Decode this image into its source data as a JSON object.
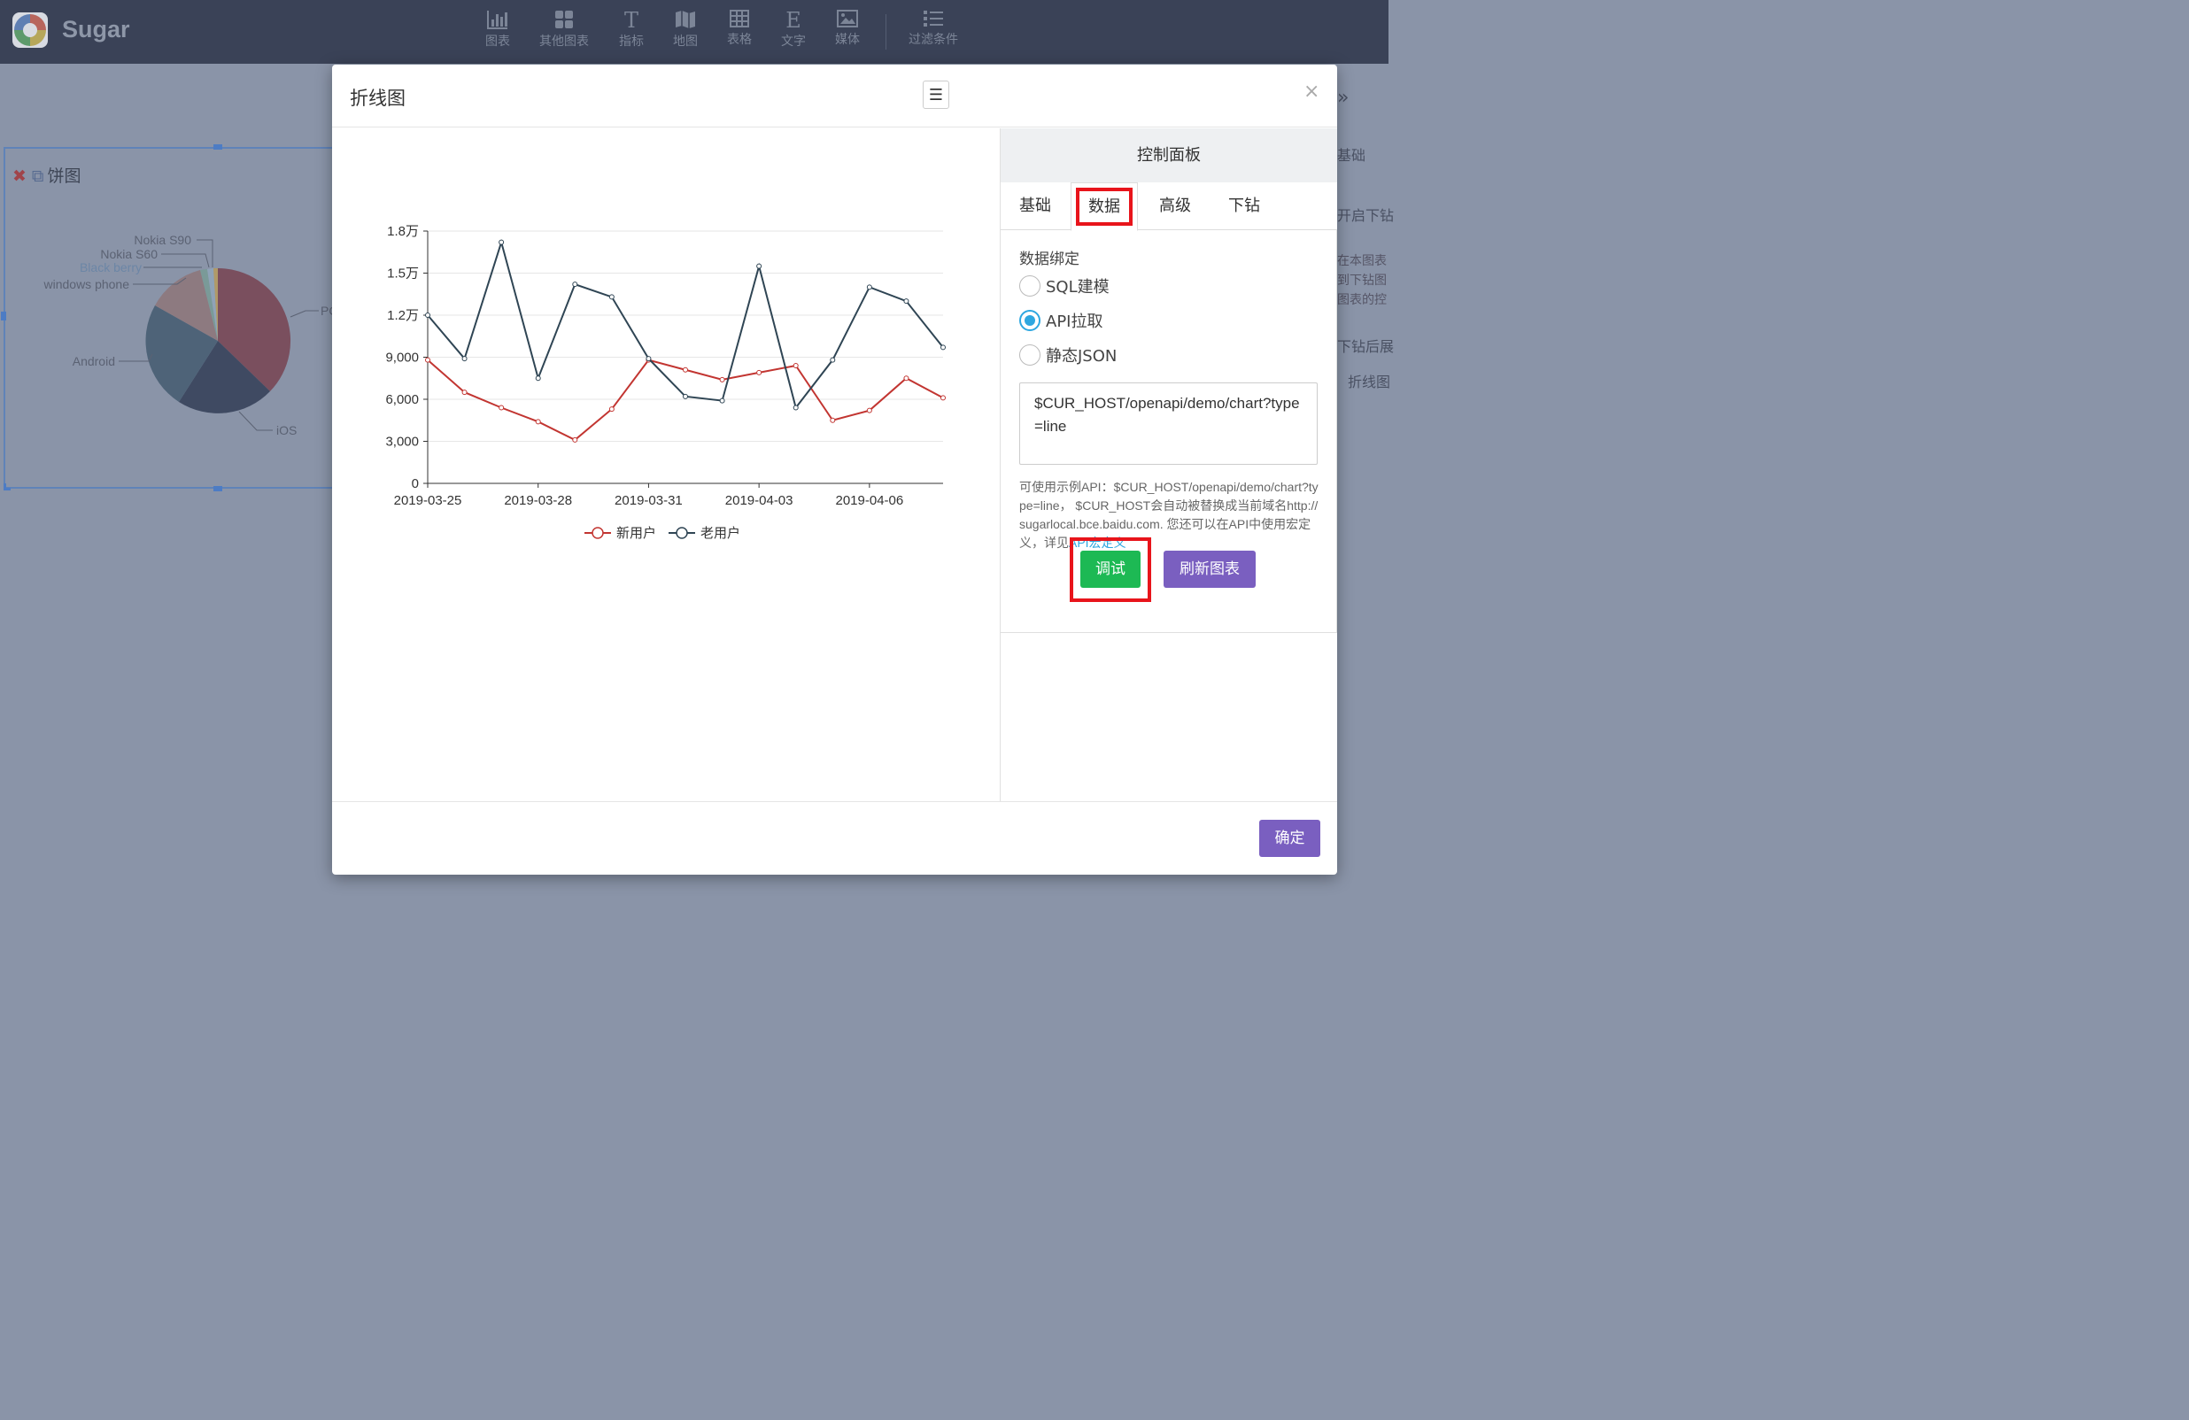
{
  "app": {
    "name": "Sugar"
  },
  "toolbar": [
    {
      "label": "图表",
      "icon": "bar-chart-icon"
    },
    {
      "label": "其他图表",
      "icon": "grid-icon"
    },
    {
      "label": "指标",
      "icon": "text-t-icon"
    },
    {
      "label": "地图",
      "icon": "map-icon"
    },
    {
      "label": "表格",
      "icon": "table-icon"
    },
    {
      "label": "文字",
      "icon": "text-e-icon"
    },
    {
      "label": "媒体",
      "icon": "image-icon"
    },
    {
      "label": "过滤条件",
      "icon": "list-icon"
    }
  ],
  "background": {
    "widget_title": "饼图",
    "pie_labels": [
      "Nokia S90",
      "Nokia S60",
      "Black berry",
      "windows phone",
      "Android",
      "iOS",
      "PC"
    ],
    "right_panel": {
      "tab": "基础",
      "text1": "开启下钻",
      "hint1": "在本图表",
      "hint2": "到下钻图",
      "hint3": "图表的控",
      "text2": "下钻后展",
      "field": "折线图"
    }
  },
  "modal": {
    "title": "折线图",
    "close": "×",
    "menu_icon": "menu-icon",
    "confirm": "确定"
  },
  "chart_data": {
    "type": "line",
    "x": [
      "2019-03-25",
      "2019-03-26",
      "2019-03-27",
      "2019-03-28",
      "2019-03-29",
      "2019-03-30",
      "2019-03-31",
      "2019-04-01",
      "2019-04-02",
      "2019-04-03",
      "2019-04-04",
      "2019-04-05",
      "2019-04-06",
      "2019-04-07",
      "2019-04-08"
    ],
    "x_tick_labels": [
      "2019-03-25",
      "2019-03-28",
      "2019-03-31",
      "2019-04-03",
      "2019-04-06"
    ],
    "y_ticks": [
      "0",
      "3,000",
      "6,000",
      "9,000",
      "1.2万",
      "1.5万",
      "1.8万"
    ],
    "ylim": [
      0,
      18000
    ],
    "grid": true,
    "legend_position": "bottom-center",
    "series": [
      {
        "name": "新用户",
        "color": "#c23531",
        "values": [
          8800,
          6500,
          5400,
          4400,
          3100,
          5300,
          8800,
          8100,
          7400,
          7900,
          8400,
          4500,
          5200,
          7500,
          6100
        ]
      },
      {
        "name": "老用户",
        "color": "#2f4554",
        "values": [
          12000,
          8900,
          17200,
          7500,
          14200,
          13300,
          8900,
          6200,
          5900,
          15500,
          5400,
          8800,
          14000,
          13000,
          9700
        ]
      }
    ]
  },
  "panel": {
    "title": "控制面板",
    "tabs": [
      "基础",
      "数据",
      "高级",
      "下钻"
    ],
    "active_tab": "数据",
    "section_title": "数据绑定",
    "options": [
      "SQL建模",
      "API拉取",
      "静态JSON"
    ],
    "selected": "API拉取",
    "api_value": "$CUR_HOST/openapi/demo/chart?type=line",
    "help_text": "可使用示例API：$CUR_HOST/openapi/demo/chart?type=line， $CUR_HOST会自动被替换成当前域名http://sugarlocal.bce.baidu.com. 您还可以在API中使用宏定义，详见",
    "help_link": "API宏定义",
    "debug_button": "调试",
    "refresh_button": "刷新图表"
  },
  "colors": {
    "nav_bg": "#3a4257",
    "accent_purple": "#7a5fc0",
    "debug_green": "#1db954",
    "highlight_red": "#e8141b",
    "radio_blue": "#2ea7e0"
  }
}
